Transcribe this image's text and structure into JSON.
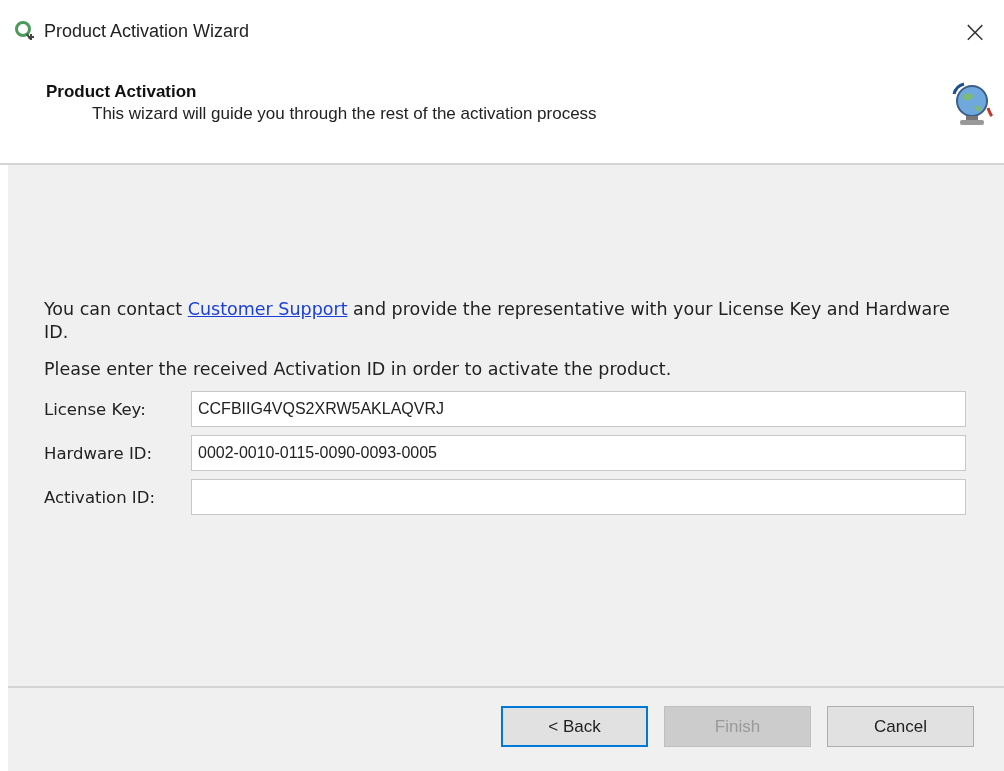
{
  "window": {
    "title": "Product Activation Wizard",
    "close": "×"
  },
  "header": {
    "title": "Product Activation",
    "subtitle": "This wizard will guide you through the rest of the activation process"
  },
  "contact": {
    "before": "You can contact ",
    "link": "Customer Support",
    "after": " and provide the representative with your License Key and Hardware ID."
  },
  "instruction": "Please enter the received Activation ID in order to activate the product.",
  "fields": [
    {
      "label": "License Key:",
      "value": "CCFBIIG4VQS2XRW5AKLAQVRJ"
    },
    {
      "label": "Hardware ID:",
      "value": "0002-0010-0115-0090-0093-0005"
    },
    {
      "label": "Activation ID:"
    }
  ],
  "buttons": [
    {
      "label": "< Back",
      "focused": true,
      "disabled": false
    },
    {
      "label": "Finish",
      "focused": false,
      "disabled": true
    },
    {
      "label": "Cancel",
      "focused": false,
      "disabled": false
    }
  ]
}
